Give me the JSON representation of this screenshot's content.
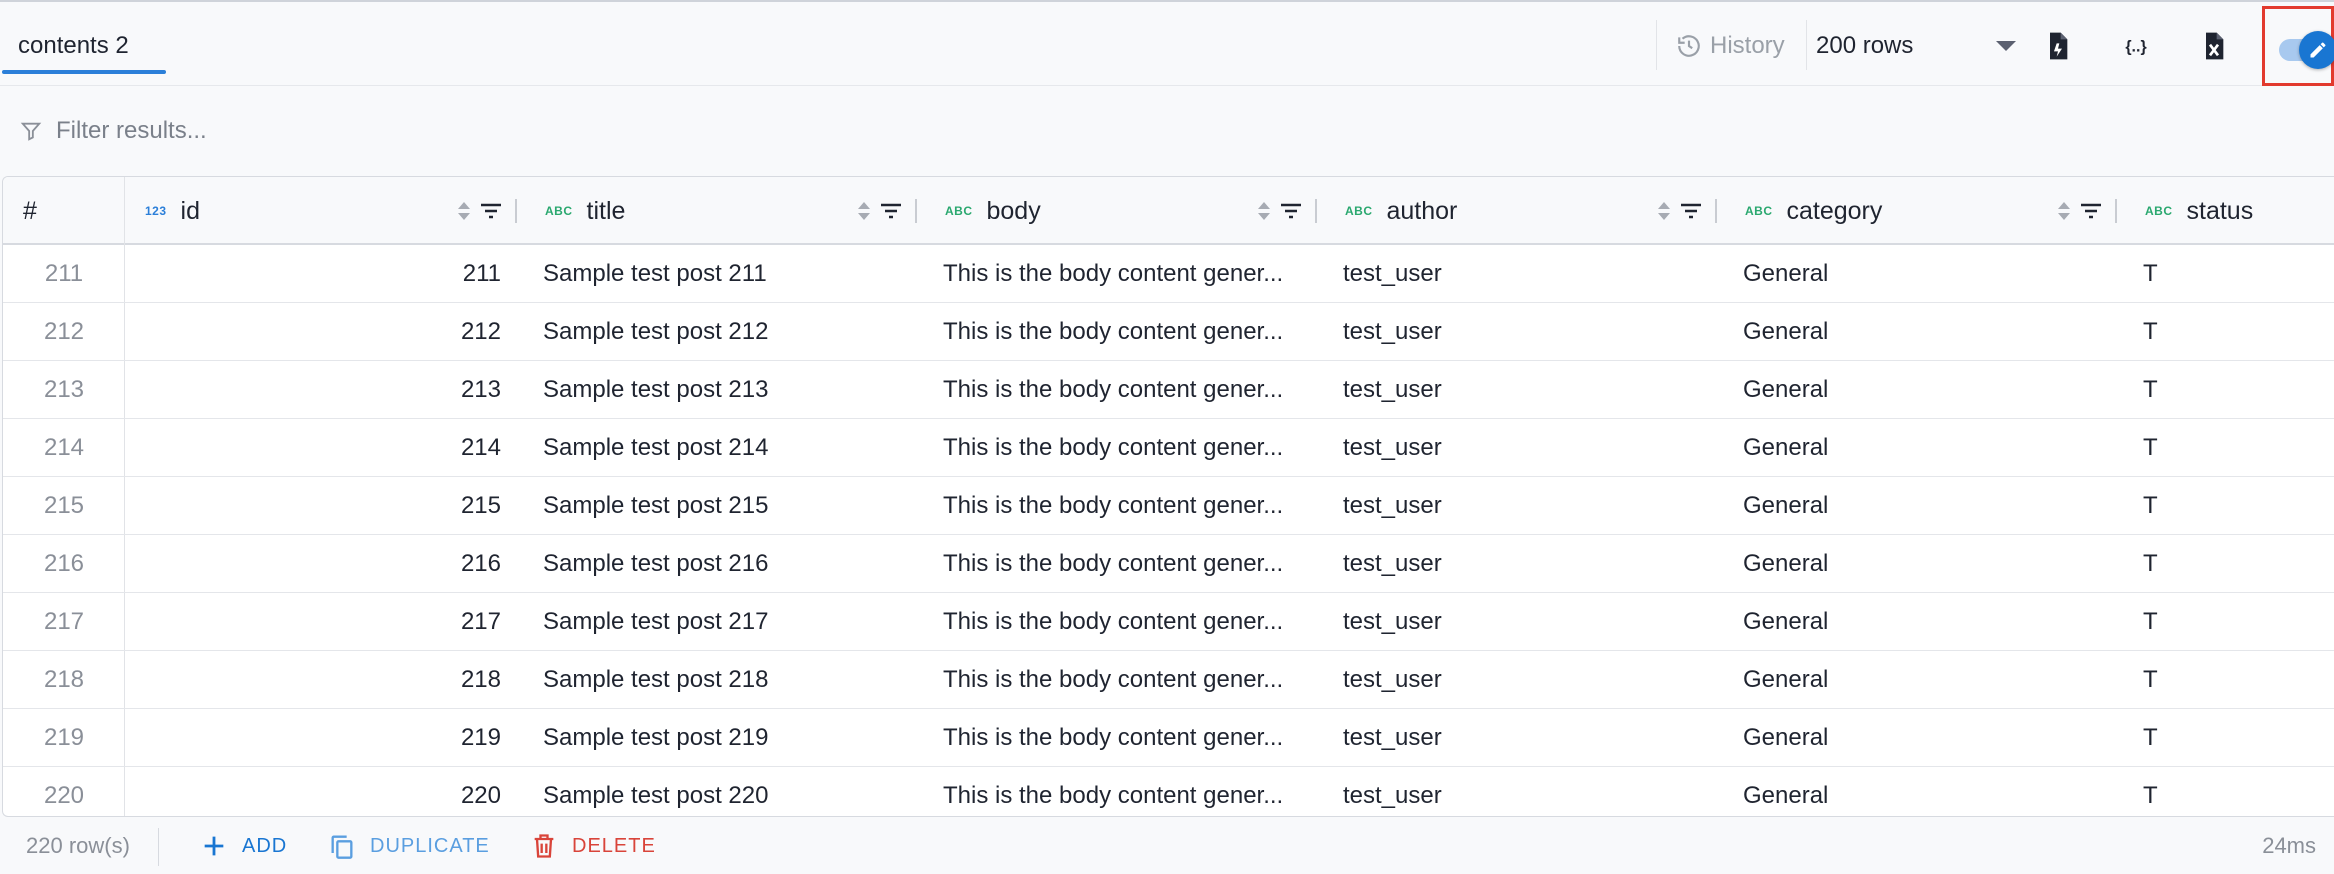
{
  "tab": {
    "label": "contents 2"
  },
  "toolbar": {
    "history_label": "History",
    "rows_value": "200 rows",
    "export_icon": "file-export-icon",
    "json_icon": "json-braces-icon",
    "excel_icon": "file-excel-icon",
    "edit_toggle": {
      "on": true,
      "icon": "pencil-icon"
    },
    "accent": "#1976d2",
    "highlight": "#e23a2e"
  },
  "filter": {
    "placeholder": "Filter results..."
  },
  "grid": {
    "rowno_header": "#",
    "columns": [
      {
        "name": "id",
        "type": "123"
      },
      {
        "name": "title",
        "type": "ABC"
      },
      {
        "name": "body",
        "type": "ABC"
      },
      {
        "name": "author",
        "type": "ABC"
      },
      {
        "name": "category",
        "type": "ABC"
      },
      {
        "name": "status",
        "type": "ABC"
      }
    ],
    "rows": [
      {
        "n": "211",
        "id": "211",
        "title": "Sample test post 211",
        "body": "This is the body content gener...",
        "author": "test_user",
        "category": "General",
        "status": "T"
      },
      {
        "n": "212",
        "id": "212",
        "title": "Sample test post 212",
        "body": "This is the body content gener...",
        "author": "test_user",
        "category": "General",
        "status": "T"
      },
      {
        "n": "213",
        "id": "213",
        "title": "Sample test post 213",
        "body": "This is the body content gener...",
        "author": "test_user",
        "category": "General",
        "status": "T"
      },
      {
        "n": "214",
        "id": "214",
        "title": "Sample test post 214",
        "body": "This is the body content gener...",
        "author": "test_user",
        "category": "General",
        "status": "T"
      },
      {
        "n": "215",
        "id": "215",
        "title": "Sample test post 215",
        "body": "This is the body content gener...",
        "author": "test_user",
        "category": "General",
        "status": "T"
      },
      {
        "n": "216",
        "id": "216",
        "title": "Sample test post 216",
        "body": "This is the body content gener...",
        "author": "test_user",
        "category": "General",
        "status": "T"
      },
      {
        "n": "217",
        "id": "217",
        "title": "Sample test post 217",
        "body": "This is the body content gener...",
        "author": "test_user",
        "category": "General",
        "status": "T"
      },
      {
        "n": "218",
        "id": "218",
        "title": "Sample test post 218",
        "body": "This is the body content gener...",
        "author": "test_user",
        "category": "General",
        "status": "T"
      },
      {
        "n": "219",
        "id": "219",
        "title": "Sample test post 219",
        "body": "This is the body content gener...",
        "author": "test_user",
        "category": "General",
        "status": "T"
      },
      {
        "n": "220",
        "id": "220",
        "title": "Sample test post 220",
        "body": "This is the body content gener...",
        "author": "test_user",
        "category": "General",
        "status": "T"
      }
    ]
  },
  "footer": {
    "row_count": "220 row(s)",
    "add_label": "ADD",
    "duplicate_label": "DUPLICATE",
    "delete_label": "DELETE",
    "timing": "24ms",
    "add_color": "#1976d2",
    "delete_color": "#d9443a"
  }
}
